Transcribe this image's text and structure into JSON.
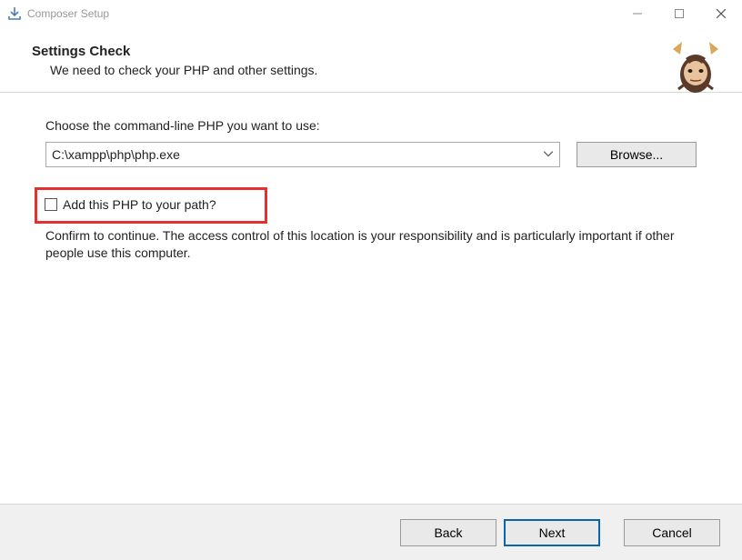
{
  "window": {
    "title": "Composer Setup"
  },
  "header": {
    "title": "Settings Check",
    "subtitle": "We need to check your PHP and other settings."
  },
  "content": {
    "choose_label": "Choose the command-line PHP you want to use:",
    "selected_php": "C:\\xampp\\php\\php.exe",
    "browse_label": "Browse...",
    "add_path_label": "Add this PHP to your path?",
    "confirm_text": "Confirm to continue. The access control of this location is your responsibility and is particularly important if other people use this computer."
  },
  "footer": {
    "back": "Back",
    "next": "Next",
    "cancel": "Cancel"
  }
}
